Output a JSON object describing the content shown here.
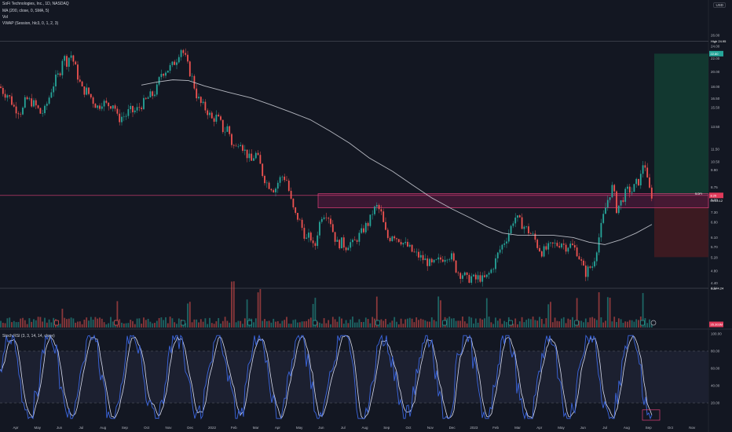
{
  "legend": {
    "title": "SoFi Technologies, Inc., 1D, NASDAQ",
    "ma": "MA (200, close, 0, SMA, 5)",
    "vol": "Vol",
    "vwap": "VWAP (Session, hlc3, 0, 1, 2, 3)",
    "stoch": "Stoch RSI (3, 3, 14, 14, close)"
  },
  "currency": "USD",
  "tags": {
    "high_label": "High",
    "high_value": "24.95",
    "low_label": "Low",
    "low_value": "4.24",
    "last_value": "8.25",
    "last_name": "SOFI",
    "countdown": "09:03:12",
    "vol_value": "35.303M",
    "zone_top": "22.80"
  },
  "chart_data": [
    {
      "type": "candlestick",
      "title": "SoFi Technologies, Inc., 1D, NASDAQ",
      "ylim": [
        4.24,
        26.0
      ],
      "y_ticks": [
        "4.24",
        "4.40",
        "4.80",
        "5.28",
        "5.70",
        "6.10",
        "6.80",
        "7.30",
        "8.00",
        "8.75",
        "9.90",
        "10.50",
        "11.50",
        "13.50",
        "15.50",
        "16.50",
        "18.00",
        "20.00",
        "22.00",
        "24.00",
        "26.00"
      ],
      "x_ticks": [
        "Apr",
        "May",
        "Jun",
        "Jul",
        "Aug",
        "Sep",
        "Oct",
        "Nov",
        "Dec",
        "2022",
        "Feb",
        "Mar",
        "Apr",
        "May",
        "Jun",
        "Jul",
        "Aug",
        "Sep",
        "Oct",
        "Nov",
        "Dec",
        "2023",
        "Feb",
        "Mar",
        "Apr",
        "May",
        "Jun",
        "Jul",
        "Aug",
        "Sep",
        "Oct",
        "Nov"
      ],
      "close_path": [
        [
          0,
          18.0
        ],
        [
          5,
          17.2
        ],
        [
          10,
          17.0
        ],
        [
          14,
          16.3
        ],
        [
          18,
          15.5
        ],
        [
          23,
          15.2
        ],
        [
          28,
          15.0
        ],
        [
          33,
          16.5
        ],
        [
          38,
          16.2
        ],
        [
          42,
          16.0
        ],
        [
          47,
          15.5
        ],
        [
          52,
          14.8
        ],
        [
          57,
          15.2
        ],
        [
          62,
          16.5
        ],
        [
          66,
          17.8
        ],
        [
          71,
          19.0
        ],
        [
          76,
          19.8
        ],
        [
          80,
          22.5
        ],
        [
          85,
          21.5
        ],
        [
          90,
          22.8
        ],
        [
          95,
          21.0
        ],
        [
          100,
          19.0
        ],
        [
          105,
          17.5
        ],
        [
          110,
          17.5
        ],
        [
          115,
          16.8
        ],
        [
          120,
          16.0
        ],
        [
          125,
          15.5
        ],
        [
          130,
          16.2
        ],
        [
          135,
          15.8
        ],
        [
          140,
          15.8
        ],
        [
          145,
          16.0
        ],
        [
          150,
          14.2
        ],
        [
          155,
          14.5
        ],
        [
          160,
          14.6
        ],
        [
          165,
          15.2
        ],
        [
          170,
          15.0
        ],
        [
          175,
          15.3
        ],
        [
          180,
          15.8
        ],
        [
          185,
          16.2
        ],
        [
          190,
          16.8
        ],
        [
          195,
          17.0
        ],
        [
          200,
          17.8
        ],
        [
          205,
          19.8
        ],
        [
          210,
          20.2
        ],
        [
          215,
          20.5
        ],
        [
          220,
          21.0
        ],
        [
          225,
          22.0
        ],
        [
          230,
          23.8
        ],
        [
          235,
          22.5
        ],
        [
          240,
          20.5
        ],
        [
          245,
          19.0
        ],
        [
          250,
          17.0
        ],
        [
          255,
          16.0
        ],
        [
          260,
          15.5
        ],
        [
          265,
          15.0
        ],
        [
          270,
          14.2
        ],
        [
          275,
          14.5
        ],
        [
          280,
          14.0
        ],
        [
          285,
          13.0
        ],
        [
          290,
          13.5
        ],
        [
          295,
          12.0
        ],
        [
          300,
          11.5
        ],
        [
          305,
          12.5
        ],
        [
          310,
          11.5
        ],
        [
          315,
          11.0
        ],
        [
          320,
          10.5
        ],
        [
          325,
          11.2
        ],
        [
          330,
          10.5
        ],
        [
          335,
          9.5
        ],
        [
          340,
          9.0
        ],
        [
          345,
          8.8
        ],
        [
          350,
          8.6
        ],
        [
          355,
          9.2
        ],
        [
          360,
          9.5
        ],
        [
          365,
          9.2
        ],
        [
          370,
          8.0
        ],
        [
          375,
          7.2
        ],
        [
          380,
          7.0
        ],
        [
          385,
          6.5
        ],
        [
          390,
          6.0
        ],
        [
          395,
          6.2
        ],
        [
          400,
          5.5
        ],
        [
          405,
          6.5
        ],
        [
          410,
          7.2
        ],
        [
          415,
          7.3
        ],
        [
          420,
          7.0
        ],
        [
          425,
          6.2
        ],
        [
          430,
          5.8
        ],
        [
          435,
          5.9
        ],
        [
          440,
          5.7
        ],
        [
          445,
          5.9
        ],
        [
          450,
          5.8
        ],
        [
          455,
          6.1
        ],
        [
          460,
          6.3
        ],
        [
          465,
          6.6
        ],
        [
          470,
          6.8
        ],
        [
          475,
          7.4
        ],
        [
          480,
          7.6
        ],
        [
          485,
          7.3
        ],
        [
          490,
          6.4
        ],
        [
          495,
          6.0
        ],
        [
          500,
          6.3
        ],
        [
          505,
          6.1
        ],
        [
          510,
          6.0
        ],
        [
          515,
          5.8
        ],
        [
          520,
          5.7
        ],
        [
          525,
          5.5
        ],
        [
          530,
          5.4
        ],
        [
          535,
          5.3
        ],
        [
          540,
          5.2
        ],
        [
          545,
          5.1
        ],
        [
          550,
          5.0
        ],
        [
          555,
          5.1
        ],
        [
          560,
          5.2
        ],
        [
          565,
          5.3
        ],
        [
          570,
          5.4
        ],
        [
          575,
          5.3
        ],
        [
          580,
          4.9
        ],
        [
          585,
          4.7
        ],
        [
          590,
          4.7
        ],
        [
          595,
          4.5
        ],
        [
          600,
          4.6
        ],
        [
          605,
          4.5
        ],
        [
          610,
          4.6
        ],
        [
          615,
          4.5
        ],
        [
          620,
          4.6
        ],
        [
          625,
          4.8
        ],
        [
          630,
          5.1
        ],
        [
          635,
          5.5
        ],
        [
          640,
          5.8
        ],
        [
          645,
          6.1
        ],
        [
          650,
          6.5
        ],
        [
          655,
          7.1
        ],
        [
          660,
          6.9
        ],
        [
          665,
          6.7
        ],
        [
          670,
          6.5
        ],
        [
          675,
          6.3
        ],
        [
          680,
          6.1
        ],
        [
          685,
          5.7
        ],
        [
          690,
          5.5
        ],
        [
          695,
          5.6
        ],
        [
          700,
          5.7
        ],
        [
          705,
          5.8
        ],
        [
          710,
          5.8
        ],
        [
          715,
          5.9
        ],
        [
          720,
          5.7
        ],
        [
          725,
          5.8
        ],
        [
          730,
          5.7
        ],
        [
          735,
          5.5
        ],
        [
          740,
          5.1
        ],
        [
          745,
          4.7
        ],
        [
          750,
          4.9
        ],
        [
          755,
          5.0
        ],
        [
          760,
          5.7
        ],
        [
          765,
          6.5
        ],
        [
          770,
          7.4
        ],
        [
          775,
          8.2
        ],
        [
          780,
          8.8
        ],
        [
          785,
          7.5
        ],
        [
          790,
          7.8
        ],
        [
          795,
          8.3
        ],
        [
          800,
          8.6
        ],
        [
          805,
          8.5
        ],
        [
          810,
          9.0
        ],
        [
          815,
          9.2
        ],
        [
          820,
          10.8
        ],
        [
          825,
          8.8
        ],
        [
          830,
          8.25
        ]
      ],
      "ma200_path": [
        [
          180,
          18.2
        ],
        [
          200,
          18.6
        ],
        [
          220,
          18.9
        ],
        [
          240,
          18.8
        ],
        [
          260,
          18.1
        ],
        [
          290,
          17.3
        ],
        [
          320,
          16.6
        ],
        [
          345,
          15.8
        ],
        [
          370,
          15.0
        ],
        [
          395,
          14.2
        ],
        [
          420,
          13.1
        ],
        [
          445,
          12.0
        ],
        [
          470,
          10.8
        ],
        [
          500,
          9.8
        ],
        [
          525,
          8.9
        ],
        [
          550,
          8.1
        ],
        [
          575,
          7.5
        ],
        [
          600,
          7.0
        ],
        [
          620,
          6.6
        ],
        [
          640,
          6.3
        ],
        [
          660,
          6.2
        ],
        [
          680,
          6.2
        ],
        [
          705,
          6.2
        ],
        [
          730,
          6.1
        ],
        [
          750,
          5.9
        ],
        [
          770,
          5.8
        ],
        [
          790,
          6.0
        ],
        [
          810,
          6.3
        ],
        [
          830,
          6.7
        ]
      ],
      "resistance_zone": {
        "top": 8.35,
        "bottom": 7.55,
        "x_start": 405
      },
      "long_position": {
        "entry": 8.25,
        "target": 22.8,
        "stop": 5.3,
        "x_start": 833
      }
    },
    {
      "type": "bar",
      "title": "Vol",
      "volume_spikes": [
        [
          80,
          3
        ],
        [
          150,
          4
        ],
        [
          240,
          5
        ],
        [
          296,
          12
        ],
        [
          315,
          5
        ],
        [
          330,
          8
        ],
        [
          400,
          5
        ],
        [
          480,
          6
        ],
        [
          560,
          6
        ],
        [
          620,
          5
        ],
        [
          700,
          4
        ],
        [
          735,
          6
        ],
        [
          762,
          7
        ],
        [
          775,
          6
        ],
        [
          818,
          8
        ]
      ]
    },
    {
      "type": "line",
      "title": "Stoch RSI (3, 3, 14, 14, close)",
      "ylim": [
        0,
        100
      ],
      "y_ticks": [
        "100.00",
        "80.00",
        "60.00",
        "40.00",
        "20.00"
      ],
      "series": [
        {
          "name": "%K",
          "color": "#4b7df2"
        },
        {
          "name": "%D",
          "color": "#e6e6e6"
        }
      ]
    }
  ],
  "colors": {
    "up": "#26a69a",
    "down": "#ef5350",
    "ma": "#d1d4dc",
    "zone_stroke": "#e0407a",
    "zone_fill": "#4a1a3a",
    "target_fill": "#123a32",
    "stop_fill": "#3e1a22",
    "stoch_k": "#3b66e0",
    "stoch_d": "#d8dcf0"
  }
}
